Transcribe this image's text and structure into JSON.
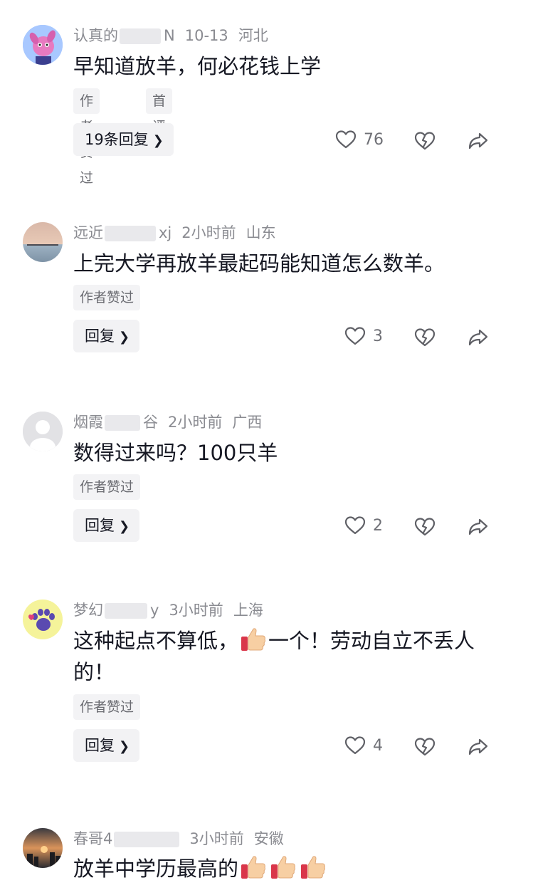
{
  "comments": [
    {
      "username": "认真的",
      "username_tail": "N",
      "time": "10-13",
      "location": "河北",
      "text": "早知道放羊，何必花钱上学",
      "tags": [
        "作者赞过",
        "首评"
      ],
      "reply_label": "19条回复",
      "likes": "76",
      "avatar": "cartoon-character-avatar"
    },
    {
      "username": "远近",
      "username_tail": "xj",
      "time": "2小时前",
      "location": "山东",
      "text": "上完大学再放羊最起码能知道怎么数羊。",
      "tags": [
        "作者赞过"
      ],
      "reply_label": "回复",
      "likes": "3",
      "avatar": "sunset-lake-avatar"
    },
    {
      "username": "烟霞",
      "username_tail": "谷",
      "time": "2小时前",
      "location": "广西",
      "text": "数得过来吗？100只羊",
      "tags": [
        "作者赞过"
      ],
      "reply_label": "回复",
      "likes": "2",
      "avatar": "default-user-avatar"
    },
    {
      "username": "梦幻",
      "username_tail": "y",
      "time": "3小时前",
      "location": "上海",
      "text_parts": [
        "这种起点不算低，",
        "一个！劳动自立不丢人的！"
      ],
      "tags": [
        "作者赞过"
      ],
      "reply_label": "回复",
      "likes": "4",
      "avatar": "paw-print-avatar"
    },
    {
      "username": "春哥4",
      "username_tail": "",
      "time": "3小时前",
      "location": "安徽",
      "text": "放羊中学历最高的",
      "avatar": "city-sunset-avatar"
    }
  ],
  "icons": {
    "like": "heart-outline-icon",
    "dislike": "broken-heart-icon",
    "share": "share-arrow-icon",
    "emoji": "thumbs-up-emoji"
  },
  "colors": {
    "text": "#161823",
    "meta": "#8a8b91",
    "tag_bg": "#f3f3f5",
    "icon": "#5f6066"
  }
}
